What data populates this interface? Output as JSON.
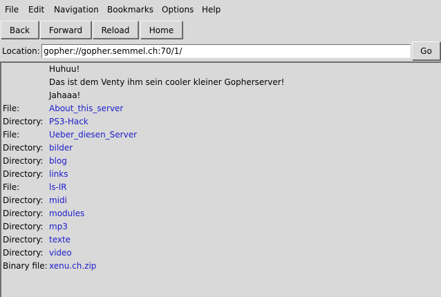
{
  "menu": [
    "File",
    "Edit",
    "Navigation",
    "Bookmarks",
    "Options",
    "Help"
  ],
  "toolbar": {
    "back": "Back",
    "forward": "Forward",
    "reload": "Reload",
    "home": "Home"
  },
  "location": {
    "label": "Location:",
    "url": "gopher://gopher.semmel.ch:70/1/",
    "go": "Go"
  },
  "colors": {
    "link": "#1c1ccc",
    "background": "#d9d9d9"
  },
  "entries": [
    {
      "type": "",
      "name": "Huhuu!"
    },
    {
      "type": "",
      "name": "Das ist dem Venty ihm sein cooler kleiner Gopherserver!"
    },
    {
      "type": "",
      "name": "Jahaaa!"
    },
    {
      "type": "File:",
      "name": "About_this_server"
    },
    {
      "type": "Directory:",
      "name": "PS3-Hack"
    },
    {
      "type": "File:",
      "name": "Ueber_diesen_Server"
    },
    {
      "type": "Directory:",
      "name": "bilder"
    },
    {
      "type": "Directory:",
      "name": "blog"
    },
    {
      "type": "Directory:",
      "name": "links"
    },
    {
      "type": "File:",
      "name": "ls-lR"
    },
    {
      "type": "Directory:",
      "name": "midi"
    },
    {
      "type": "Directory:",
      "name": "modules"
    },
    {
      "type": "Directory:",
      "name": "mp3"
    },
    {
      "type": "Directory:",
      "name": "texte"
    },
    {
      "type": "Directory:",
      "name": "video"
    },
    {
      "type": "Binary file:",
      "name": "xenu.ch.zip"
    }
  ]
}
